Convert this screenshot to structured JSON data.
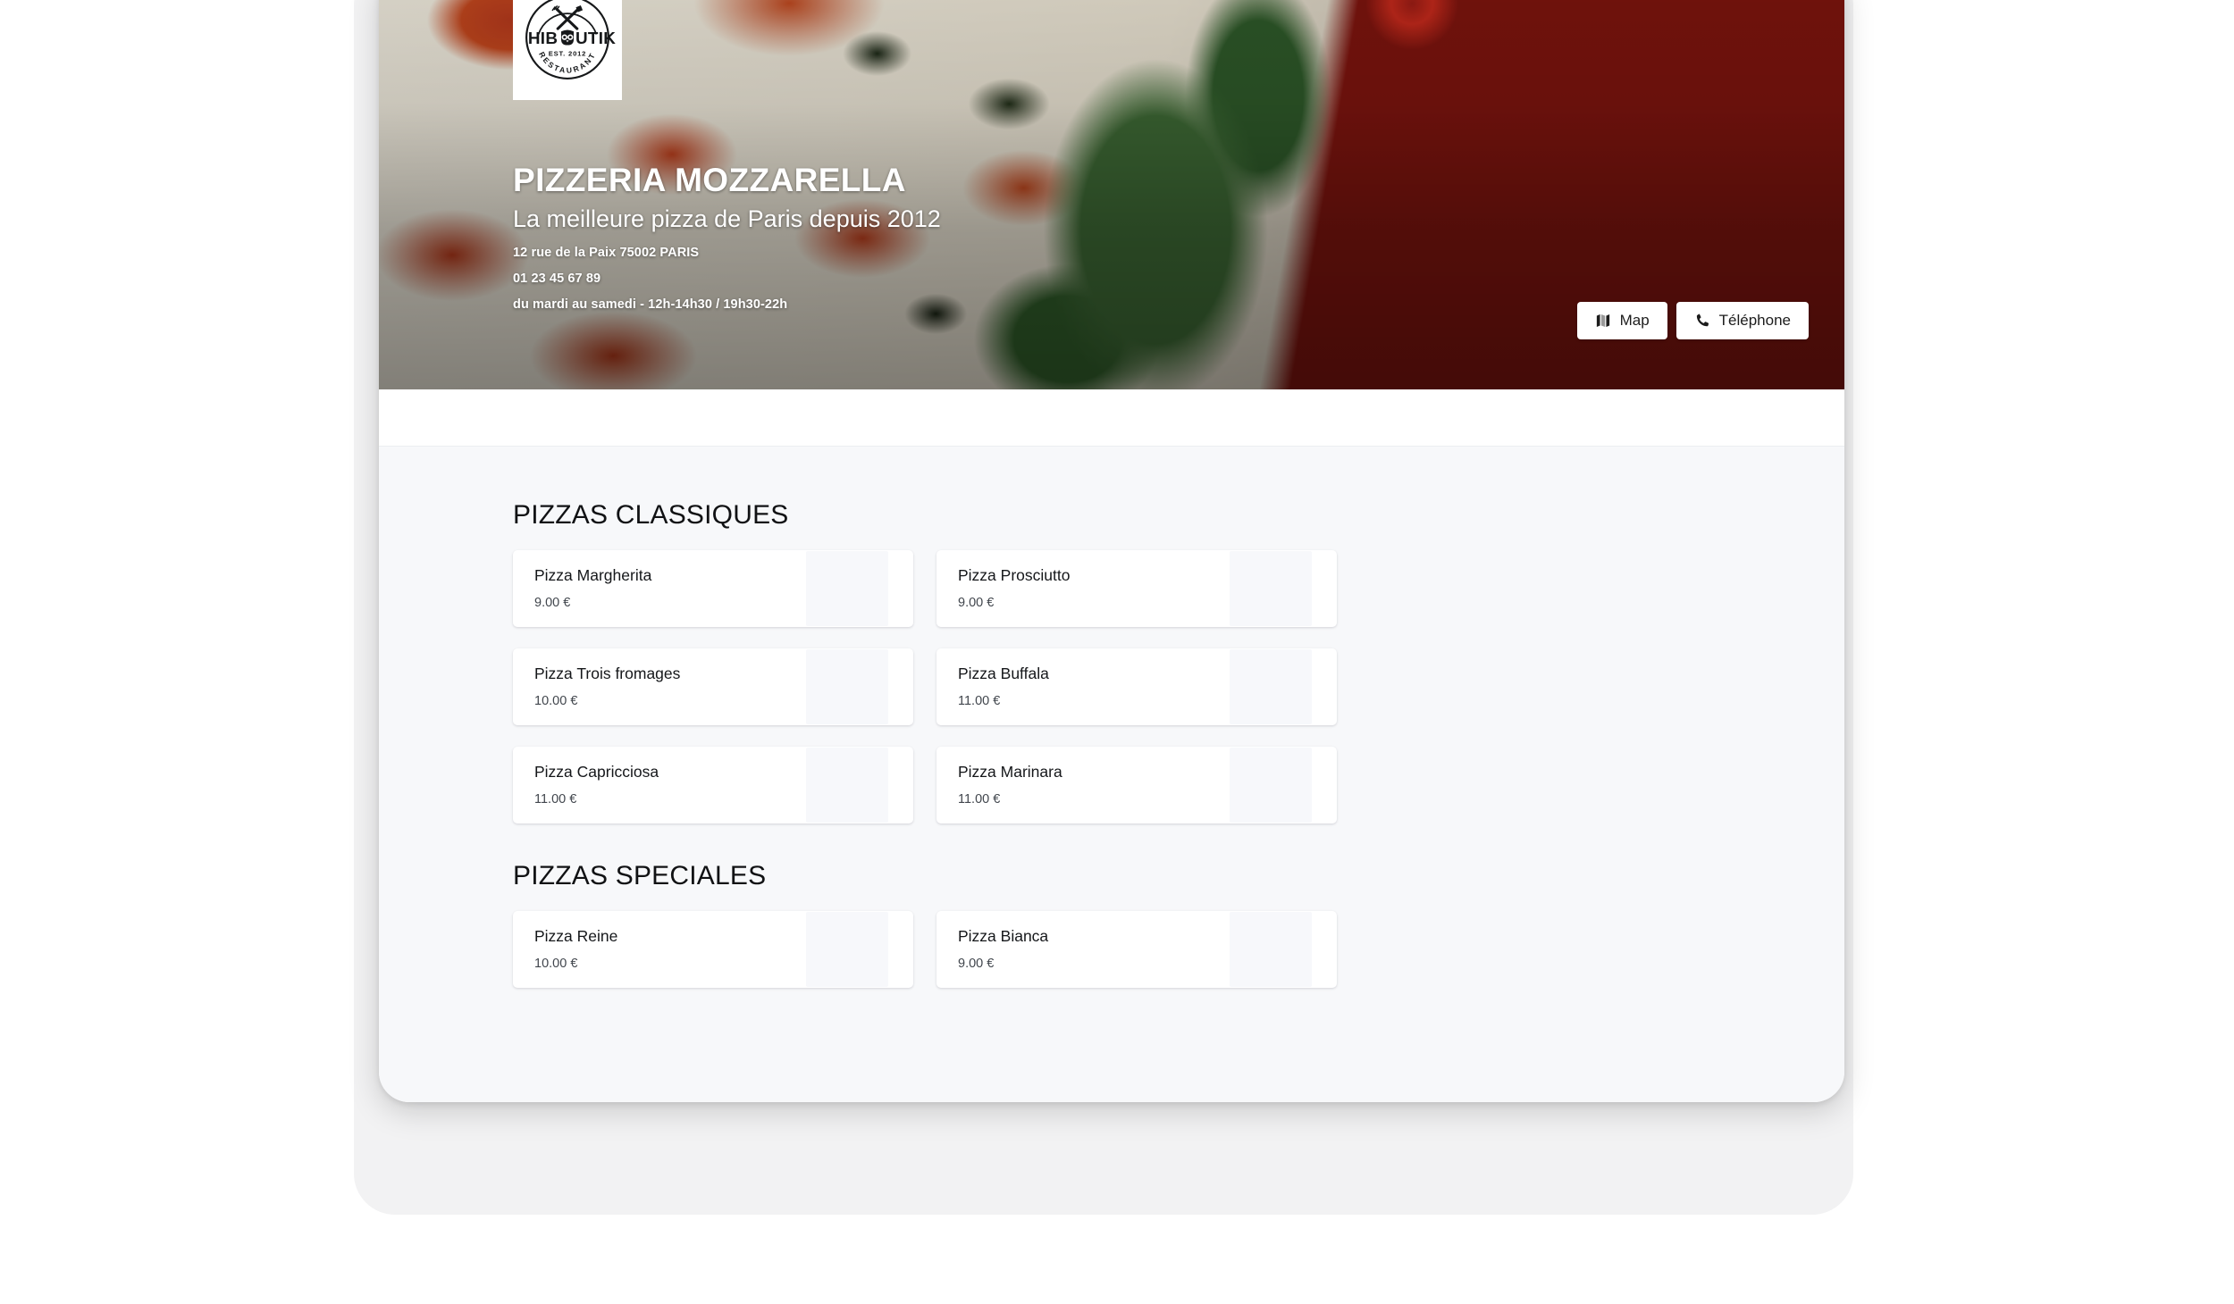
{
  "brand": {
    "logo_name": "HIBOUTIK",
    "logo_word_left": "HIB",
    "logo_word_right": "UTIK",
    "logo_est": "EST. 2012",
    "logo_arc": "RESTAURANT"
  },
  "hero": {
    "title": "PIZZERIA MOZZARELLA",
    "subtitle": "La meilleure pizza de Paris depuis 2012",
    "address": "12 rue de la Paix 75002 PARIS",
    "phone": "01 23 45 67 89",
    "hours": "du mardi au samedi - 12h-14h30 / 19h30-22h",
    "buttons": [
      {
        "label": "Map",
        "icon": "map-icon"
      },
      {
        "label": "Téléphone",
        "icon": "phone-icon"
      }
    ]
  },
  "colors": {
    "page_background": "#f7f8fa",
    "card_background": "#ffffff",
    "thumb_placeholder": "#f7f8fb",
    "text_primary": "#15171a",
    "text_secondary": "#41464d",
    "frame_outer": "#f2f2f3"
  },
  "menu": {
    "sections": [
      {
        "title": "PIZZAS CLASSIQUES",
        "items": [
          {
            "name": "Pizza Margherita",
            "price": "9.00 €"
          },
          {
            "name": "Pizza Prosciutto",
            "price": "9.00 €"
          },
          {
            "name": "Pizza Trois fromages",
            "price": "10.00 €"
          },
          {
            "name": "Pizza Buffala",
            "price": "11.00 €"
          },
          {
            "name": "Pizza Capricciosa",
            "price": "11.00 €"
          },
          {
            "name": "Pizza Marinara",
            "price": "11.00 €"
          }
        ]
      },
      {
        "title": "PIZZAS SPECIALES",
        "items": [
          {
            "name": "Pizza Reine",
            "price": "10.00 €"
          },
          {
            "name": "Pizza Bianca",
            "price": "9.00 €"
          }
        ]
      }
    ]
  }
}
